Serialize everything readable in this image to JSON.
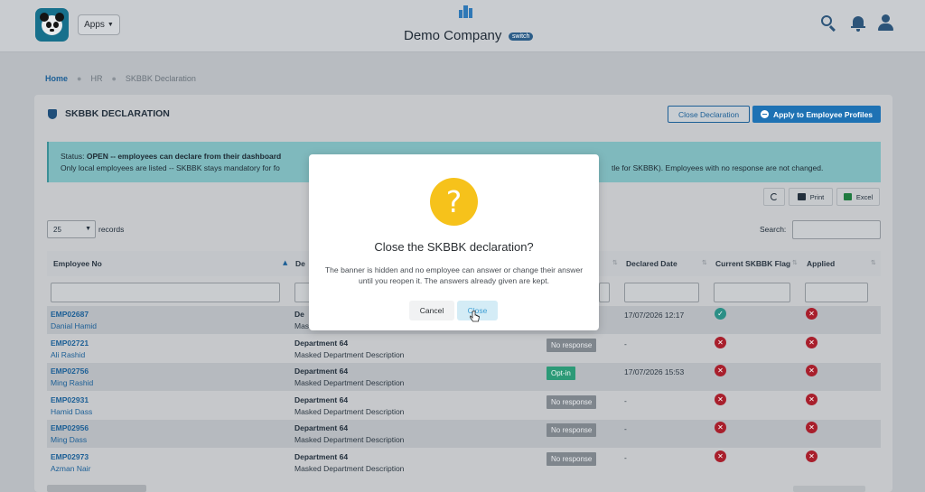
{
  "header": {
    "apps_label": "Apps",
    "company_name": "Demo Company",
    "switch_label": "switch"
  },
  "breadcrumb": {
    "home": "Home",
    "section": "HR",
    "current": "SKBBK Declaration"
  },
  "card": {
    "title": "SKBBK DECLARATION",
    "close_declaration_label": "Close Declaration",
    "apply_label": "Apply to Employee Profiles"
  },
  "alert": {
    "status_prefix": "Status:",
    "status_text": "OPEN -- employees can declare from their dashboard",
    "line2_left": "Only local employees are listed -- SKBBK stays mandatory for fo",
    "line2_right": "tle for SKBBK). Employees with no response are not changed."
  },
  "toolbar": {
    "print_label": "Print",
    "excel_label": "Excel"
  },
  "table_controls": {
    "page_length": "25",
    "records_label": "records",
    "search_label": "Search:"
  },
  "table": {
    "headers": [
      "Employee No",
      "De",
      "Declared Date",
      "Current SKBBK Flag",
      "Applied"
    ],
    "rows": [
      {
        "emp_no": "EMP02687",
        "name": "Danial Hamid",
        "dept": "De",
        "desc": "Mas",
        "response": "",
        "date": "17/07/2026 12:17",
        "flag": "check",
        "applied": "x"
      },
      {
        "emp_no": "EMP02721",
        "name": "Ali Rashid",
        "dept": "Department 64",
        "desc": "Masked Department Description",
        "response": "No response",
        "date": "-",
        "flag": "x",
        "applied": "x"
      },
      {
        "emp_no": "EMP02756",
        "name": "Ming Rashid",
        "dept": "Department 64",
        "desc": "Masked Department Description",
        "response": "Opt-in",
        "date": "17/07/2026 15:53",
        "flag": "x",
        "applied": "x"
      },
      {
        "emp_no": "EMP02931",
        "name": "Hamid Dass",
        "dept": "Department 64",
        "desc": "Masked Department Description",
        "response": "No response",
        "date": "-",
        "flag": "x",
        "applied": "x"
      },
      {
        "emp_no": "EMP02956",
        "name": "Ming Dass",
        "dept": "Department 64",
        "desc": "Masked Department Description",
        "response": "No response",
        "date": "-",
        "flag": "x",
        "applied": "x"
      },
      {
        "emp_no": "EMP02973",
        "name": "Azman Nair",
        "dept": "Department 64",
        "desc": "Masked Department Description",
        "response": "No response",
        "date": "-",
        "flag": "x",
        "applied": "x"
      }
    ]
  },
  "modal": {
    "icon": "?",
    "title": "Close the SKBBK declaration?",
    "text": "The banner is hidden and no employee can answer or change their answer until you reopen it. The answers already given are kept.",
    "cancel_label": "Cancel",
    "confirm_label": "Close"
  },
  "colors": {
    "primary": "#1e72b4",
    "alert_bg": "#7fb9bd",
    "question_icon": "#f6c21b",
    "badge_no_response": "#7f868d",
    "badge_opt_in": "#2c9a77",
    "icon_x": "#a81f2c",
    "icon_check": "#2b8f86"
  }
}
